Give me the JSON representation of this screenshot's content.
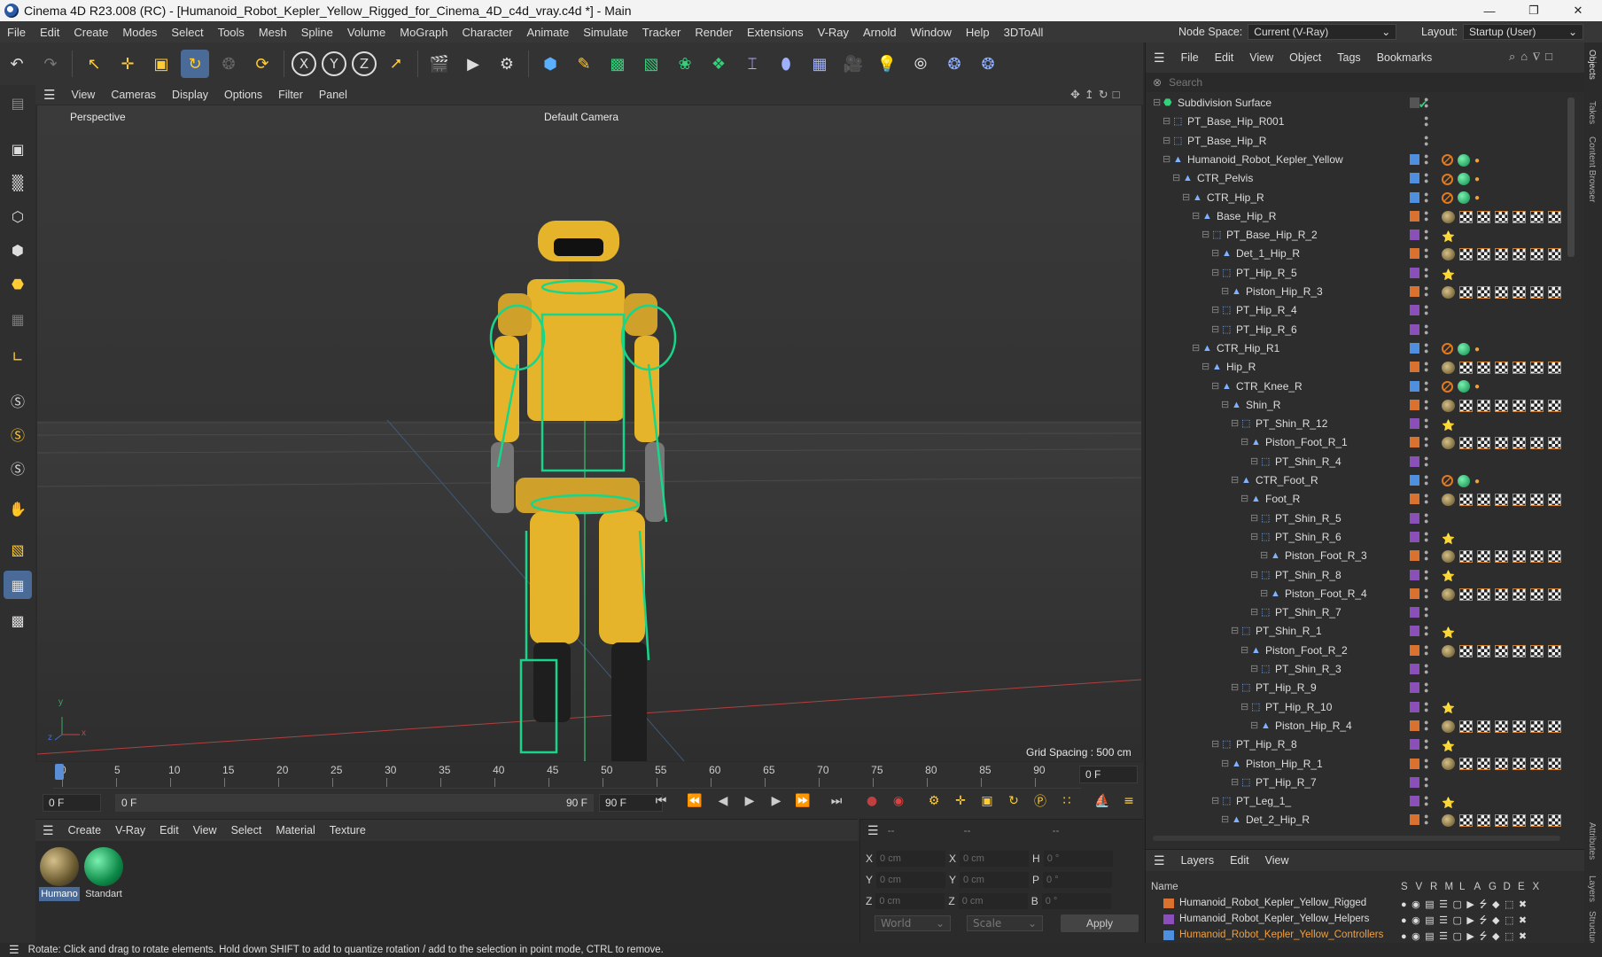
{
  "window": {
    "title": "Cinema 4D R23.008 (RC) - [Humanoid_Robot_Kepler_Yellow_Rigged_for_Cinema_4D_c4d_vray.c4d *] - Main"
  },
  "menu": [
    "File",
    "Edit",
    "Create",
    "Modes",
    "Select",
    "Tools",
    "Mesh",
    "Spline",
    "Volume",
    "MoGraph",
    "Character",
    "Animate",
    "Simulate",
    "Tracker",
    "Render",
    "Extensions",
    "V-Ray",
    "Arnold",
    "Window",
    "Help",
    "3DToAll"
  ],
  "nodespace": {
    "label": "Node Space:",
    "value": "Current (V-Ray)"
  },
  "layout": {
    "label": "Layout:",
    "value": "Startup (User)"
  },
  "viewport": {
    "menu": [
      "View",
      "Cameras",
      "Display",
      "Options",
      "Filter",
      "Panel"
    ],
    "name": "Perspective",
    "camera": "Default Camera",
    "grid": "Grid Spacing : 500 cm",
    "axis_y": "y",
    "axis_x": "x",
    "axis_z": "z"
  },
  "timeline": {
    "ticks": [
      "0",
      "5",
      "10",
      "15",
      "20",
      "25",
      "30",
      "35",
      "40",
      "45",
      "50",
      "55",
      "60",
      "65",
      "70",
      "75",
      "80",
      "85",
      "90"
    ],
    "current": "0 F",
    "start": "0 F",
    "range_start": "0 F",
    "range_end": "90 F",
    "end": "90 F",
    "end_field": "0 F"
  },
  "material_manager": {
    "menu": [
      "Create",
      "V-Ray",
      "Edit",
      "View",
      "Select",
      "Material",
      "Texture"
    ],
    "materials": [
      {
        "label": "Humano"
      },
      {
        "label": "Standart"
      }
    ]
  },
  "coordinates": {
    "headers": [
      "--",
      "--",
      "--"
    ],
    "rows": [
      {
        "a": "X",
        "av": "0 cm",
        "b": "X",
        "bv": "0 cm",
        "c": "H",
        "cv": "0 °"
      },
      {
        "a": "Y",
        "av": "0 cm",
        "b": "Y",
        "bv": "0 cm",
        "c": "P",
        "cv": "0 °"
      },
      {
        "a": "Z",
        "av": "0 cm",
        "b": "Z",
        "bv": "0 cm",
        "c": "B",
        "cv": "0 °"
      }
    ],
    "world": "World",
    "scale": "Scale",
    "apply": "Apply"
  },
  "status": "Rotate: Click and drag to rotate elements. Hold down SHIFT to add to quantize rotation / add to the selection in point mode, CTRL to remove.",
  "object_manager": {
    "menu": [
      "File",
      "Edit",
      "View",
      "Object",
      "Tags",
      "Bookmarks"
    ],
    "search_placeholder": "Search",
    "objects": [
      {
        "name": "Subdivision Surface",
        "depth": 0,
        "icon": "subdiv",
        "layer": "",
        "tags": "subdiv"
      },
      {
        "name": "PT_Base_Hip_R001",
        "depth": 1,
        "icon": "null",
        "layer": "",
        "tags": ""
      },
      {
        "name": "PT_Base_Hip_R",
        "depth": 1,
        "icon": "null",
        "layer": "",
        "tags": ""
      },
      {
        "name": "Humanoid_Robot_Kepler_Yellow",
        "depth": 1,
        "icon": "joint",
        "layer": "#4f8fe0",
        "tags": "ctrl"
      },
      {
        "name": "CTR_Pelvis",
        "depth": 2,
        "icon": "joint",
        "layer": "#4f8fe0",
        "tags": "ctrl"
      },
      {
        "name": "CTR_Hip_R",
        "depth": 3,
        "icon": "joint",
        "layer": "#4f8fe0",
        "tags": "ctrl"
      },
      {
        "name": "Base_Hip_R",
        "depth": 4,
        "icon": "joint",
        "layer": "#d9722e",
        "tags": "mat"
      },
      {
        "name": "PT_Base_Hip_R_2",
        "depth": 5,
        "icon": "null",
        "layer": "#8a4fb8",
        "tags": "bl"
      },
      {
        "name": "Det_1_Hip_R",
        "depth": 6,
        "icon": "joint",
        "layer": "#d9722e",
        "tags": "mat"
      },
      {
        "name": "PT_Hip_R_5",
        "depth": 6,
        "icon": "null",
        "layer": "#8a4fb8",
        "tags": "bl"
      },
      {
        "name": "Piston_Hip_R_3",
        "depth": 7,
        "icon": "joint",
        "layer": "#d9722e",
        "tags": "mat"
      },
      {
        "name": "PT_Hip_R_4",
        "depth": 6,
        "icon": "null",
        "layer": "#8a4fb8",
        "tags": ""
      },
      {
        "name": "PT_Hip_R_6",
        "depth": 6,
        "icon": "null",
        "layer": "#8a4fb8",
        "tags": ""
      },
      {
        "name": "CTR_Hip_R1",
        "depth": 4,
        "icon": "joint",
        "layer": "#4f8fe0",
        "tags": "ctrl"
      },
      {
        "name": "Hip_R",
        "depth": 5,
        "icon": "joint",
        "layer": "#d9722e",
        "tags": "mat"
      },
      {
        "name": "CTR_Knee_R",
        "depth": 6,
        "icon": "joint",
        "layer": "#4f8fe0",
        "tags": "ctrl"
      },
      {
        "name": "Shin_R",
        "depth": 7,
        "icon": "joint",
        "layer": "#d9722e",
        "tags": "mat"
      },
      {
        "name": "PT_Shin_R_12",
        "depth": 8,
        "icon": "null",
        "layer": "#8a4fb8",
        "tags": "bl"
      },
      {
        "name": "Piston_Foot_R_1",
        "depth": 9,
        "icon": "joint",
        "layer": "#d9722e",
        "tags": "mat"
      },
      {
        "name": "PT_Shin_R_4",
        "depth": 10,
        "icon": "null",
        "layer": "#8a4fb8",
        "tags": ""
      },
      {
        "name": "CTR_Foot_R",
        "depth": 8,
        "icon": "joint",
        "layer": "#4f8fe0",
        "tags": "ctrl"
      },
      {
        "name": "Foot_R",
        "depth": 9,
        "icon": "joint",
        "layer": "#d9722e",
        "tags": "mat"
      },
      {
        "name": "PT_Shin_R_5",
        "depth": 10,
        "icon": "null",
        "layer": "#8a4fb8",
        "tags": ""
      },
      {
        "name": "PT_Shin_R_6",
        "depth": 10,
        "icon": "null",
        "layer": "#8a4fb8",
        "tags": "bl"
      },
      {
        "name": "Piston_Foot_R_3",
        "depth": 11,
        "icon": "joint",
        "layer": "#d9722e",
        "tags": "mat"
      },
      {
        "name": "PT_Shin_R_8",
        "depth": 10,
        "icon": "null",
        "layer": "#8a4fb8",
        "tags": "bl"
      },
      {
        "name": "Piston_Foot_R_4",
        "depth": 11,
        "icon": "joint",
        "layer": "#d9722e",
        "tags": "mat"
      },
      {
        "name": "PT_Shin_R_7",
        "depth": 10,
        "icon": "null",
        "layer": "#8a4fb8",
        "tags": ""
      },
      {
        "name": "PT_Shin_R_1",
        "depth": 8,
        "icon": "null",
        "layer": "#8a4fb8",
        "tags": "bl"
      },
      {
        "name": "Piston_Foot_R_2",
        "depth": 9,
        "icon": "joint",
        "layer": "#d9722e",
        "tags": "mat"
      },
      {
        "name": "PT_Shin_R_3",
        "depth": 10,
        "icon": "null",
        "layer": "#8a4fb8",
        "tags": ""
      },
      {
        "name": "PT_Hip_R_9",
        "depth": 8,
        "icon": "null",
        "layer": "#8a4fb8",
        "tags": ""
      },
      {
        "name": "PT_Hip_R_10",
        "depth": 9,
        "icon": "null",
        "layer": "#8a4fb8",
        "tags": "bl"
      },
      {
        "name": "Piston_Hip_R_4",
        "depth": 10,
        "icon": "joint",
        "layer": "#d9722e",
        "tags": "mat"
      },
      {
        "name": "PT_Hip_R_8",
        "depth": 6,
        "icon": "null",
        "layer": "#8a4fb8",
        "tags": "bl"
      },
      {
        "name": "Piston_Hip_R_1",
        "depth": 7,
        "icon": "joint",
        "layer": "#d9722e",
        "tags": "mat"
      },
      {
        "name": "PT_Hip_R_7",
        "depth": 8,
        "icon": "null",
        "layer": "#8a4fb8",
        "tags": ""
      },
      {
        "name": "PT_Leg_1_",
        "depth": 6,
        "icon": "null",
        "layer": "#8a4fb8",
        "tags": "bl"
      },
      {
        "name": "Det_2_Hip_R",
        "depth": 7,
        "icon": "joint",
        "layer": "#d9722e",
        "tags": "mat"
      }
    ]
  },
  "layers_manager": {
    "menu": [
      "Layers",
      "Edit",
      "View"
    ],
    "name_header": "Name",
    "col_headers": [
      "S",
      "V",
      "R",
      "M",
      "L",
      "A",
      "G",
      "D",
      "E",
      "X"
    ],
    "layers": [
      {
        "name": "Humanoid_Robot_Kepler_Yellow_Rigged",
        "color": "#d9722e",
        "active": false
      },
      {
        "name": "Humanoid_Robot_Kepler_Yellow_Helpers",
        "color": "#8a4fb8",
        "active": false
      },
      {
        "name": "Humanoid_Robot_Kepler_Yellow_Controllers",
        "color": "#4f8fe0",
        "active": true
      }
    ]
  },
  "side_tabs": [
    "Objects",
    "Takes",
    "Content Browser",
    "Attributes",
    "Layers",
    "Structure"
  ],
  "colors": {
    "accent": "#4a6a98",
    "rig": "#17d68a",
    "robot": "#e6b42a"
  }
}
